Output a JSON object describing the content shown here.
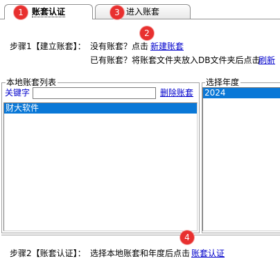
{
  "tabs": [
    {
      "label": "账套认证",
      "active": true,
      "marker": "1"
    },
    {
      "label": "进入账套",
      "active": false,
      "marker": "3"
    }
  ],
  "markers": {
    "create": "2",
    "auth": "4"
  },
  "step1": {
    "label": "步骤1【建立账套】：",
    "no_account_text": "没有账套？点击",
    "new_link": "新建账套",
    "has_account_text": "已有账套？将账套文件夹放入DB文件夹后点击",
    "refresh_link": "刷新"
  },
  "local_list": {
    "title": "本地账套列表",
    "keyword_label": "关键字",
    "keyword_value": "",
    "delete_link": "删除账套",
    "items": [
      "财大软件"
    ],
    "selected_index": 0
  },
  "year_select": {
    "title": "选择年度",
    "items": [
      "2024"
    ],
    "selected_index": 0
  },
  "step2": {
    "label": "步骤2【账套认证】：",
    "text": "选择本地账套和年度后点击",
    "auth_link": "账套认证"
  },
  "colors": {
    "marker": "#e8302f",
    "selection": "#0a78d7",
    "link": "#0000cc"
  }
}
